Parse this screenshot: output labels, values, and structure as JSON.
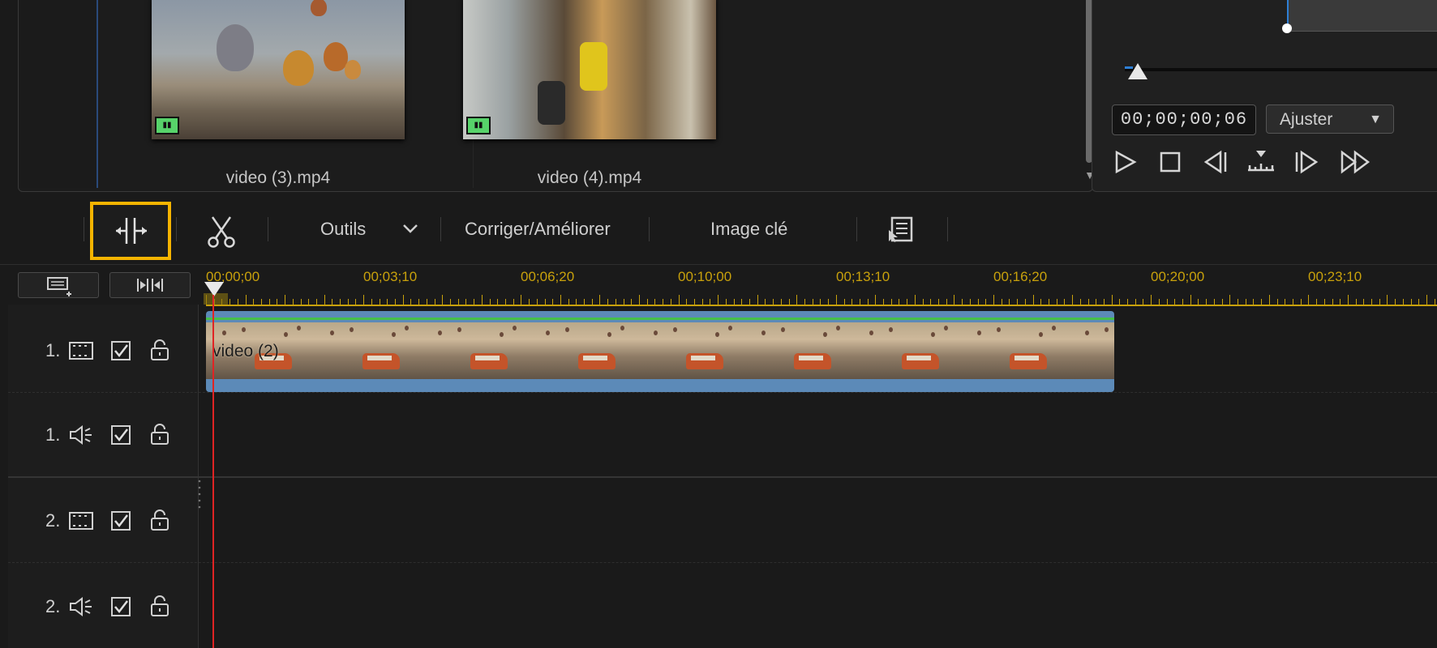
{
  "media_library": {
    "items": [
      {
        "name": "video (3).mp4"
      },
      {
        "name": "video (4).mp4"
      }
    ]
  },
  "preview": {
    "timecode": "00;00;00;06",
    "fit_mode": "Ajuster",
    "fit_caret": "▼",
    "playhead_position": 0.03,
    "buttons": {
      "play": "▷",
      "stop": "□",
      "prev_frame": "◁|",
      "next_frame": "|▷",
      "fast_forward": "▷▷"
    }
  },
  "toolbar": {
    "tools_label": "Outils",
    "enhance_label": "Corriger/Améliorer",
    "keyframe_label": "Image clé"
  },
  "timeline": {
    "ruler_labels": [
      "00;00;00",
      "00;03;10",
      "00;06;20",
      "00;10;00",
      "00;13;10",
      "00;16;20",
      "00;20;00",
      "00;23;10"
    ],
    "tracks": [
      {
        "number": "1.",
        "type": "video",
        "icon": "film-track-icon"
      },
      {
        "number": "1.",
        "type": "audio",
        "icon": "speaker-icon"
      },
      {
        "number": "2.",
        "type": "video",
        "icon": "film-track-icon"
      },
      {
        "number": "2.",
        "type": "audio",
        "icon": "speaker-icon"
      }
    ],
    "clip": {
      "label": "video (2)",
      "track": 1
    }
  },
  "colors": {
    "highlight": "#f5b400",
    "ruler": "#c8a10c",
    "playhead": "#e02424",
    "clip": "#5c8ab8",
    "clip_audio_line": "#46c04a"
  }
}
